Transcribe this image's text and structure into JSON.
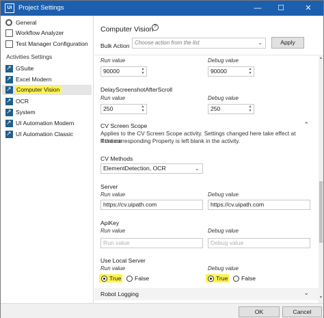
{
  "window": {
    "title": "Project Settings",
    "app_icon": "Ui",
    "controls": {
      "minimize": "—",
      "maximize": "☐",
      "close": "✕"
    }
  },
  "sidebar": {
    "items": [
      {
        "label": "General",
        "icon": "gear-icon"
      },
      {
        "label": "Workflow Analyzer",
        "icon": "analyzer-icon"
      },
      {
        "label": "Test Manager Configuration",
        "icon": "test-manager-icon"
      }
    ],
    "section_label": "Activities Settings",
    "activity_items": [
      {
        "label": "GSuite",
        "icon": "activity-icon"
      },
      {
        "label": "Excel Modern",
        "icon": "activity-icon"
      },
      {
        "label": "Computer Vision",
        "icon": "activity-icon",
        "selected": true
      },
      {
        "label": "OCR",
        "icon": "activity-icon"
      },
      {
        "label": "System",
        "icon": "activity-icon"
      },
      {
        "label": "UI Automation Modern",
        "icon": "activity-icon"
      },
      {
        "label": "UI Automation Classic",
        "icon": "activity-icon"
      }
    ]
  },
  "main": {
    "title": "Computer Vision",
    "help_glyph": "?",
    "bulk_action": {
      "label": "Bulk Action",
      "placeholder": "Choose action from the list",
      "apply_label": "Apply"
    },
    "run_value_label": "Run value",
    "debug_value_label": "Debug value",
    "first": {
      "run": "90000",
      "debug": "90000"
    },
    "delay": {
      "title": "DelayScreenshotAfterScroll",
      "run": "250",
      "debug": "250"
    },
    "cv_scope": {
      "title": "CV Screen Scope",
      "description_line1": "Applies to the CV Screen Scope activity. Settings changed here take effect at Runtime",
      "description_line2": "if the corresponding Property is left blank in the activity."
    },
    "cv_methods": {
      "title": "CV Methods",
      "value": "ElementDetection, OCR"
    },
    "server": {
      "title": "Server",
      "run": "https://cv.uipath.com",
      "debug": "https://cv.uipath.com"
    },
    "apikey": {
      "title": "ApiKey",
      "run_placeholder": "Run value",
      "debug_placeholder": "Debug value"
    },
    "local_server": {
      "title": "Use Local Server",
      "true_label": "True",
      "false_label": "False",
      "run_selected": "True",
      "debug_selected": "True"
    },
    "robot_logging": {
      "title": "Robot Logging"
    }
  },
  "footer": {
    "ok_label": "OK",
    "cancel_label": "Cancel"
  },
  "colors": {
    "titlebar": "#1c5fae",
    "highlight": "#fff34a",
    "selected_bg": "#e5e5e5"
  }
}
